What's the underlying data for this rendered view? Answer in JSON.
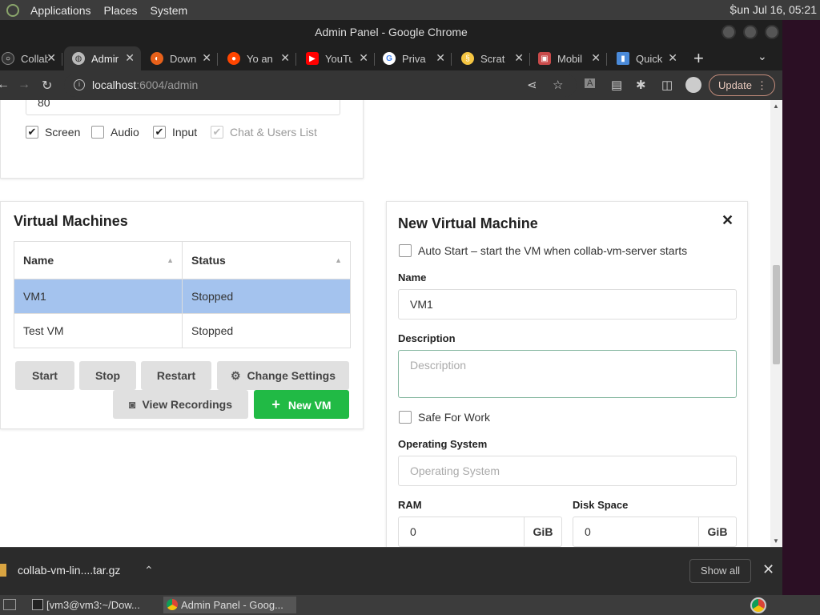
{
  "top_panel": {
    "menus": [
      "Applications",
      "Places",
      "System"
    ],
    "clock": "Sun Jul 16, 05:21"
  },
  "window": {
    "title": "Admin Panel - Google Chrome"
  },
  "tabs": [
    {
      "title": "Collab",
      "icon": "collab-icon"
    },
    {
      "title": "Admin",
      "icon": "globe-icon",
      "active": true
    },
    {
      "title": "Down",
      "icon": "download-site-icon"
    },
    {
      "title": "Yo an",
      "icon": "reddit-icon"
    },
    {
      "title": "YouTu",
      "icon": "youtube-icon"
    },
    {
      "title": "Priva",
      "icon": "google-icon"
    },
    {
      "title": "Scrat",
      "icon": "scratch-icon"
    },
    {
      "title": "Mobil",
      "icon": "mobile-icon"
    },
    {
      "title": "Quick",
      "icon": "quick-icon"
    }
  ],
  "toolbar": {
    "url_host": "localhost",
    "url_path": ":6004/admin",
    "update_label": "Update"
  },
  "settings_panel": {
    "port_value": "80",
    "checks": [
      {
        "label": "Screen",
        "checked": true,
        "disabled": false
      },
      {
        "label": "Audio",
        "checked": false,
        "disabled": false
      },
      {
        "label": "Input",
        "checked": true,
        "disabled": false
      },
      {
        "label": "Chat & Users List",
        "checked": true,
        "disabled": true
      }
    ]
  },
  "vm_panel": {
    "title": "Virtual Machines",
    "columns": [
      "Name",
      "Status"
    ],
    "rows": [
      {
        "name": "VM1",
        "status": "Stopped",
        "selected": true
      },
      {
        "name": "Test VM",
        "status": "Stopped",
        "selected": false
      }
    ],
    "buttons": {
      "start": "Start",
      "stop": "Stop",
      "restart": "Restart",
      "change_settings": "Change Settings",
      "view_recordings": "View Recordings",
      "new_vm": "New VM"
    }
  },
  "new_vm_panel": {
    "title": "New Virtual Machine",
    "auto_start_label": "Auto Start – start the VM when collab-vm-server starts",
    "name_label": "Name",
    "name_value": "VM1",
    "description_label": "Description",
    "description_placeholder": "Description",
    "safe_for_work_label": "Safe For Work",
    "os_label": "Operating System",
    "os_placeholder": "Operating System",
    "ram_label": "RAM",
    "ram_value": "0",
    "ram_unit": "GiB",
    "disk_label": "Disk Space",
    "disk_value": "0",
    "disk_unit": "GiB"
  },
  "download_bar": {
    "file_name": "collab-vm-lin....tar.gz",
    "show_all": "Show all"
  },
  "taskbar": {
    "tasks": [
      "[vm3@vm3:~/Dow...",
      "Admin Panel - Goog..."
    ]
  },
  "colors": {
    "selected_row": "#a4c3ee",
    "new_vm_button": "#21ba45",
    "update_border": "#c58d7c"
  }
}
